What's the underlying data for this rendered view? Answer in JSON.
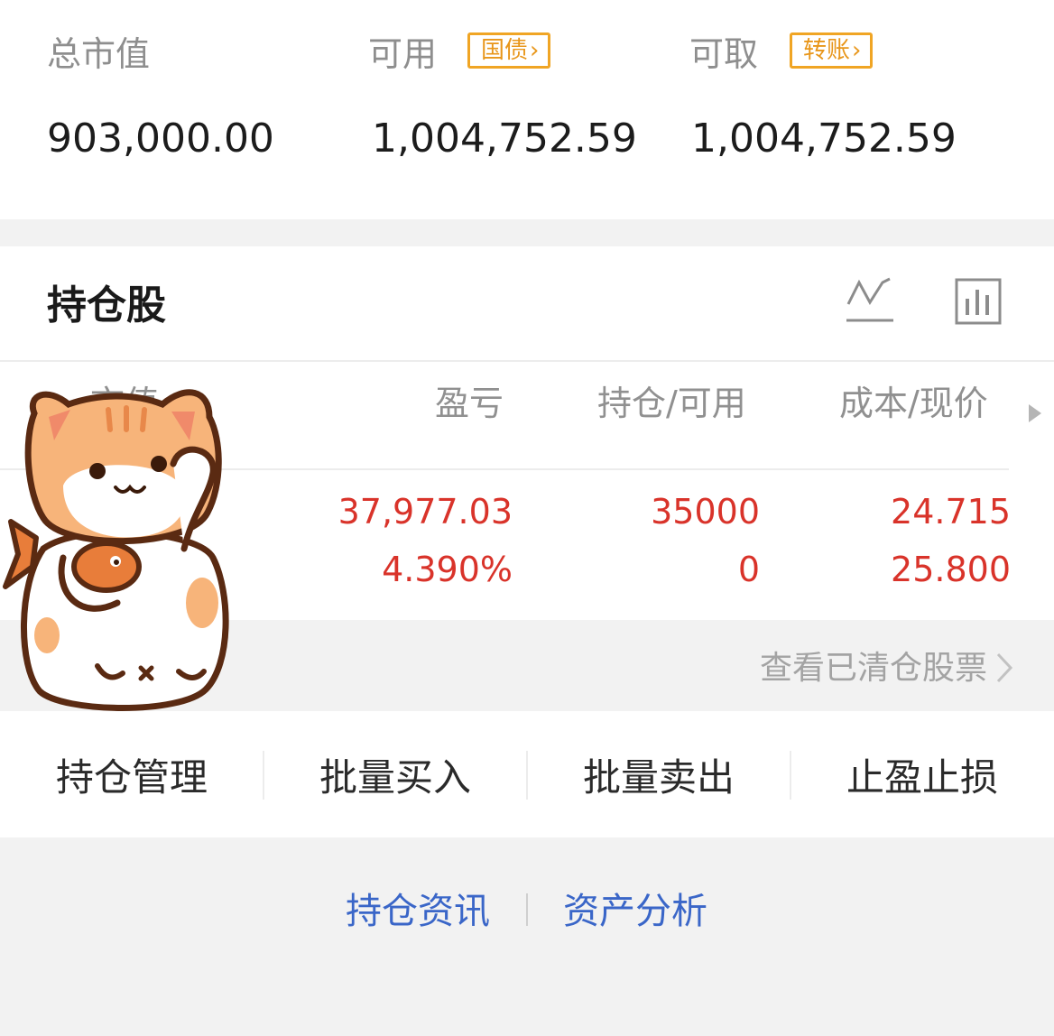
{
  "summary": {
    "total_value_label": "总市值",
    "total_value": "903,000.00",
    "available_label": "可用",
    "available_tag": "国债",
    "available_value": "1,004,752.59",
    "withdrawable_label": "可取",
    "withdrawable_tag": "转账",
    "withdrawable_value": "1,004,752.59",
    "tag_color": "#f0a524"
  },
  "holdings": {
    "title": "持仓股",
    "icons": [
      "line-chart-icon",
      "bar-chart-icon"
    ],
    "columns": [
      "市值",
      "盈亏",
      "持仓/可用",
      "成本/现价"
    ],
    "rows": [
      {
        "profit": "37,977.03",
        "profit_pct": "4.390%",
        "position": "35000",
        "available": "0",
        "cost": "24.715",
        "price": "25.800"
      }
    ],
    "gain_color": "#d9332a"
  },
  "cleared": {
    "label": "查看已清仓股票"
  },
  "actions": [
    "持仓管理",
    "批量买入",
    "批量卖出",
    "止盈止损"
  ],
  "links": {
    "news": "持仓资讯",
    "analysis": "资产分析",
    "link_color": "#3a66c8"
  },
  "sticker": "lucky-cat-sticker"
}
